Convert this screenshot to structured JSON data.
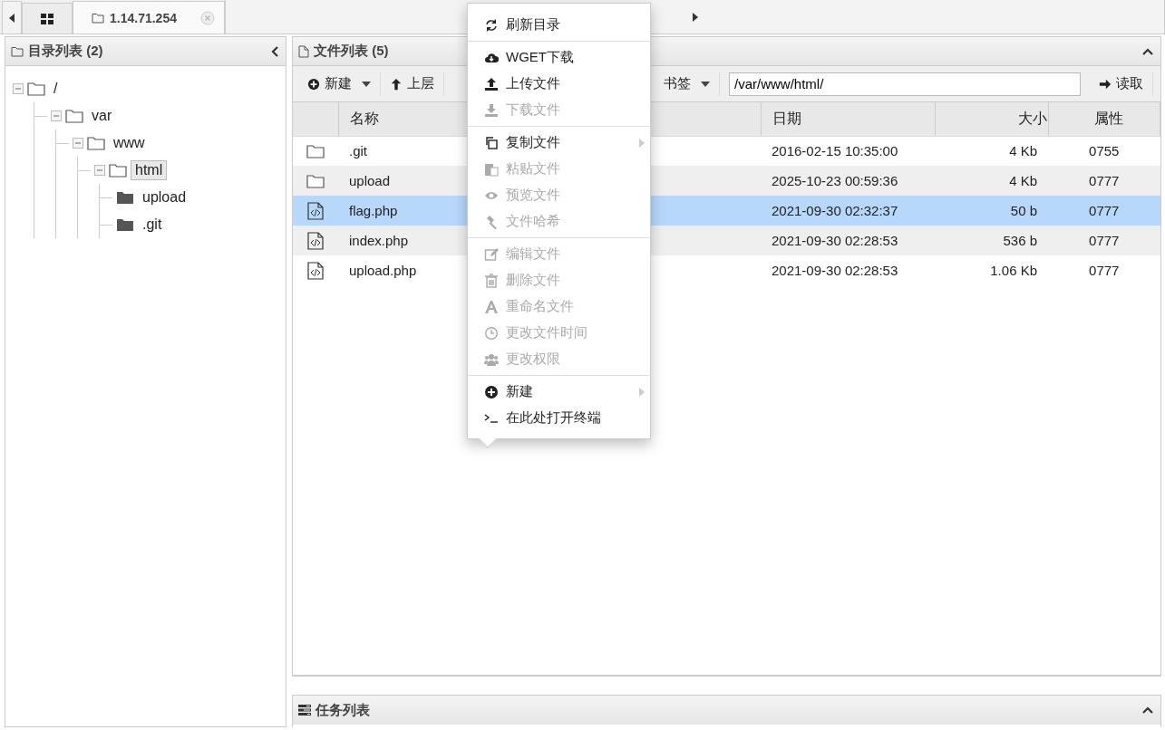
{
  "tabs": [
    {
      "kind": "home",
      "selected": false
    },
    {
      "kind": "host",
      "label": "1.14.71.254",
      "selected": true
    }
  ],
  "dir_panel": {
    "title": "目录列表 (2)",
    "tree": [
      {
        "label": "/",
        "expanded": true,
        "selected": false,
        "children": [
          {
            "label": "var",
            "expanded": true,
            "selected": false,
            "children": [
              {
                "label": "www",
                "expanded": true,
                "selected": false,
                "children": [
                  {
                    "label": "html",
                    "expanded": true,
                    "selected": true,
                    "children": [
                      {
                        "label": "upload",
                        "expanded": false,
                        "selected": false
                      },
                      {
                        "label": ".git",
                        "expanded": false,
                        "selected": false
                      }
                    ]
                  }
                ]
              }
            ]
          }
        ]
      }
    ]
  },
  "file_panel": {
    "title": "文件列表 (5)",
    "toolbar": [
      {
        "kind": "new",
        "label": "新建",
        "dropdown": true
      },
      {
        "kind": "up",
        "label": "上层",
        "dropdown": false
      },
      {
        "kind": "bookmark",
        "label": "书签",
        "dropdown": true
      }
    ],
    "path": "/var/www/html/",
    "read_button": "读取",
    "columns": [
      "名称",
      "日期",
      "大小",
      "属性"
    ],
    "rows": [
      {
        "kind": "folder",
        "name": ".git",
        "date": "2016-02-15 10:35:00",
        "size": "4 Kb",
        "mode": "0755",
        "selected": false
      },
      {
        "kind": "folder",
        "name": "upload",
        "date": "2025-10-23 00:59:36",
        "size": "4 Kb",
        "mode": "0777",
        "selected": false
      },
      {
        "kind": "code",
        "name": "flag.php",
        "date": "2021-09-30 02:32:37",
        "size": "50 b",
        "mode": "0777",
        "selected": true
      },
      {
        "kind": "code",
        "name": "index.php",
        "date": "2021-09-30 02:28:53",
        "size": "536 b",
        "mode": "0777",
        "selected": false
      },
      {
        "kind": "code",
        "name": "upload.php",
        "date": "2021-09-30 02:28:53",
        "size": "1.06 Kb",
        "mode": "0777",
        "selected": false
      }
    ]
  },
  "task_panel": {
    "title": "任务列表"
  },
  "context_menu": [
    [
      {
        "label": "刷新目录",
        "disabled": false,
        "submenu": false
      }
    ],
    [
      {
        "label": "WGET下载",
        "disabled": false,
        "submenu": false
      },
      {
        "label": "上传文件",
        "disabled": false,
        "submenu": false
      },
      {
        "label": "下载文件",
        "disabled": true,
        "submenu": false
      }
    ],
    [
      {
        "label": "复制文件",
        "disabled": false,
        "submenu": true
      },
      {
        "label": "粘贴文件",
        "disabled": true,
        "submenu": false
      },
      {
        "label": "预览文件",
        "disabled": true,
        "submenu": false
      },
      {
        "label": "文件哈希",
        "disabled": true,
        "submenu": false
      }
    ],
    [
      {
        "label": "编辑文件",
        "disabled": true,
        "submenu": false
      },
      {
        "label": "删除文件",
        "disabled": true,
        "submenu": false
      },
      {
        "label": "重命名文件",
        "disabled": true,
        "submenu": false
      },
      {
        "label": "更改文件时间",
        "disabled": true,
        "submenu": false
      },
      {
        "label": "更改权限",
        "disabled": true,
        "submenu": false
      }
    ],
    [
      {
        "label": "新建",
        "disabled": false,
        "submenu": true
      },
      {
        "label": "在此处打开终端",
        "disabled": false,
        "submenu": false
      }
    ]
  ]
}
